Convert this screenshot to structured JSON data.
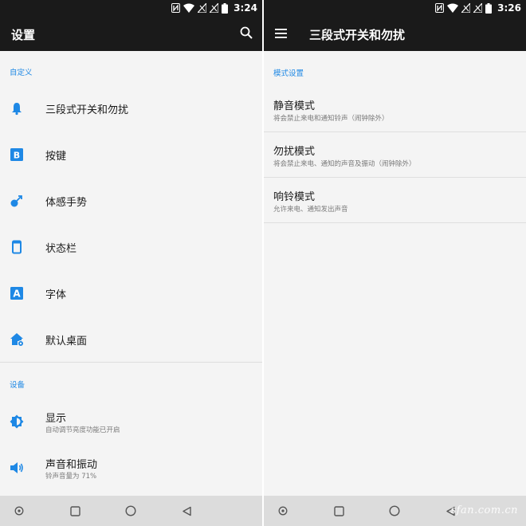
{
  "colors": {
    "accent": "#1e88e5",
    "bar": "#1a1a1a",
    "background": "#f4f4f4",
    "navbar": "#dcdcdc"
  },
  "left": {
    "status": {
      "time": "3:24"
    },
    "appbar": {
      "title": "设置",
      "action_icon": "search-icon"
    },
    "sections": [
      {
        "header": "自定义"
      },
      {
        "header": "设备"
      }
    ],
    "items": [
      {
        "label": "三段式开关和勿扰",
        "icon": "bell-icon"
      },
      {
        "label": "按键",
        "icon": "key-b-icon"
      },
      {
        "label": "体感手势",
        "icon": "gesture-icon"
      },
      {
        "label": "状态栏",
        "icon": "phone-outline-icon"
      },
      {
        "label": "字体",
        "icon": "font-a-icon"
      },
      {
        "label": "默认桌面",
        "icon": "home-gear-icon"
      },
      {
        "label": "显示",
        "sub": "自动调节亮度功能已开启",
        "icon": "brightness-icon"
      },
      {
        "label": "声音和振动",
        "sub": "铃声音量为 71%",
        "icon": "volume-icon"
      }
    ]
  },
  "right": {
    "status": {
      "time": "3:26"
    },
    "appbar": {
      "title": "三段式开关和勿扰",
      "nav_icon": "menu-icon"
    },
    "section": {
      "header": "模式设置"
    },
    "modes": [
      {
        "title": "静音模式",
        "sub": "将会禁止来电和通知铃声（闹钟除外）"
      },
      {
        "title": "勿扰模式",
        "sub": "将会禁止来电、通知的声音及振动（闹钟除外）"
      },
      {
        "title": "响铃模式",
        "sub": "允许来电、通知发出声音"
      }
    ]
  },
  "navbar": {
    "icons": [
      "home-dot-icon",
      "recents-icon",
      "home-circle-icon",
      "back-icon"
    ]
  },
  "watermark": "sfan.com.cn"
}
